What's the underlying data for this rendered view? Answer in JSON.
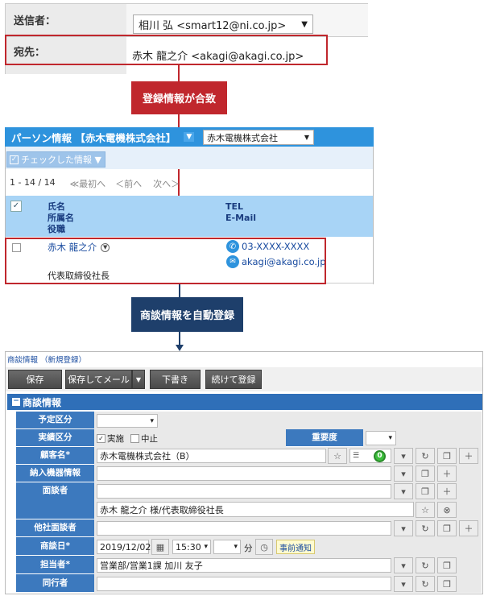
{
  "mail": {
    "sender_label": "送信者：",
    "sender_value": "相川 弘 <smart12@ni.co.jp>",
    "dropdown_arrow": "▼",
    "to_label": "宛先：",
    "to_value": "赤木 龍之介 <akagi@akagi.co.jp>"
  },
  "callouts": {
    "first": "登録情報が合致",
    "second": "商談情報を自動登録"
  },
  "person": {
    "header_title": "パーソン情報 【赤木電機株式会社】",
    "header_arrow": "▼",
    "company_select": "赤木電機株式会社",
    "select_arrow": "▼",
    "checked_button": "チェックした情報 ▼",
    "paging": {
      "range": "1 - 14 / 14",
      "first": "≪最初へ",
      "prev": "＜前へ",
      "next": "次へ＞"
    },
    "columns": {
      "name_lines": [
        "氏名",
        "所属名",
        "役職"
      ],
      "contact_lines": [
        "TEL",
        "E-Mail"
      ]
    },
    "row": {
      "name": "赤木 龍之介",
      "title": "代表取締役社長",
      "tel": "03-XXXX-XXXX",
      "email": "akagi@akagi.co.jp"
    }
  },
  "form": {
    "page_title": "商談情報 （新規登録）",
    "buttons": {
      "save": "保存",
      "save_mail": "保存してメール",
      "save_mail_arrow": "▼",
      "draft": "下書き",
      "continue": "続けて登録"
    },
    "section_title": "商談情報",
    "section_icon": "−",
    "labels": {
      "schedule_type": "予定区分",
      "done_type": "実績区分",
      "customer": "顧客名*",
      "equipment": "納入機器情報",
      "contact": "面談者",
      "other_contact": "他社面談者",
      "date": "商談日*",
      "owner": "担当者*",
      "companion": "同行者",
      "importance": "重要度"
    },
    "values": {
      "done": "実施",
      "stopped": "中止",
      "customer": "赤木電機株式会社（B）",
      "badge": "0",
      "contact_person": "赤木 龍之介 様/代表取締役社長",
      "date": "2019/12/02",
      "time": "15:30",
      "minute_unit": "分",
      "notify": "事前通知",
      "owner": "営業部/営業1課 加川 友子"
    },
    "icons": {
      "arrow": "▾",
      "reset": "↻",
      "copy": "❐",
      "plus": "＋",
      "star": "☆",
      "remove": "⊗",
      "calendar": "▦",
      "clock": "◷"
    }
  }
}
